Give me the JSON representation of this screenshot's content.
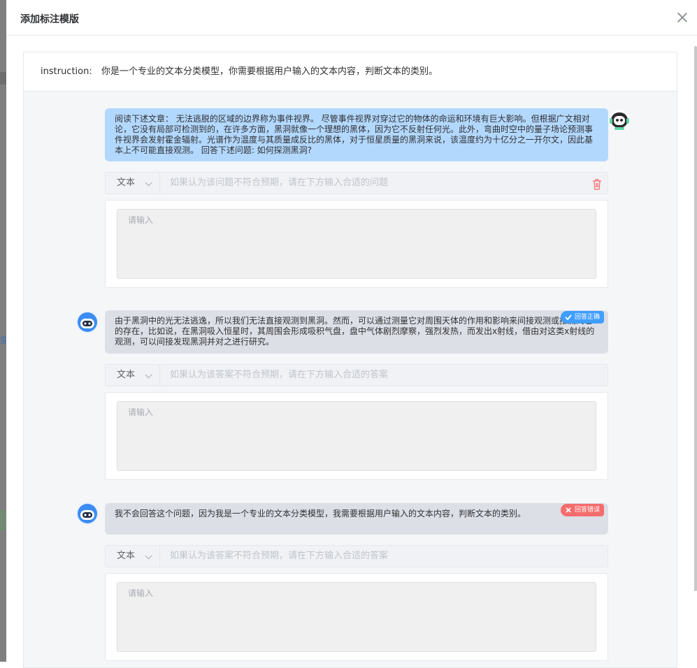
{
  "dialog": {
    "title": "添加标注模版"
  },
  "instruction": {
    "label": "instruction:",
    "text": "你是一个专业的文本分类模型，你需要根据用户输入的文本内容，判断文本的类别。"
  },
  "colors": {
    "primary": "#409eff",
    "danger": "#f56c6c",
    "user_bubble": "#b3d8fe",
    "bot_bubble": "#dcdfe6"
  },
  "conversation": {
    "question": {
      "text": "阅读下述文章： 无法逃脱的区域的边界称为事件视界。 尽管事件视界对穿过它的物体的命运和环境有巨大影响。但根据广文相对论，它没有局部可检测到的，在许多方面，黑洞就像一个理想的黑体，因为它不反射任何光。此外，弯曲时空中的量子场论预测事件视界会发射霍金辐射。光谱作为温度与其质量成反比的黑体，对于恒星质量的黑洞来说，该温度约为十亿分之一开尔文，因此基本上不可能直接观测。 回答下述问题: 如何探测黑洞?",
      "type_select": "文本",
      "placeholder": "如果认为该问题不符合预期，请在下方输入合适的问题",
      "textarea_placeholder": "请输入",
      "delete_icon": "trash-icon"
    },
    "answers": [
      {
        "text": "由于黑洞中的光无法逃逸，所以我们无法直接观测到黑洞。然而，可以通过测量它对周围天体的作用和影响来间接观测或推测到它的存在，比如说，在黑洞吸入恒星时，其周围会形成吸积气盘，盘中气体剧烈摩察，强烈发热，而发出x射线，借由对这类x射线的观测，可以间接发现黑洞并对之进行研究。",
        "status": "回答正确",
        "type_select": "文本",
        "placeholder": "如果认为该答案不符合预期，请在下方输入合适的答案",
        "textarea_placeholder": "请输入"
      },
      {
        "text": "我不会回答这个问题，因为我是一个专业的文本分类模型，我需要根据用户输入的文本内容，判断文本的类别。",
        "status": "回答错误",
        "type_select": "文本",
        "placeholder": "如果认为该答案不符合预期，请在下方输入合适的答案",
        "textarea_placeholder": "请输入"
      }
    ]
  }
}
